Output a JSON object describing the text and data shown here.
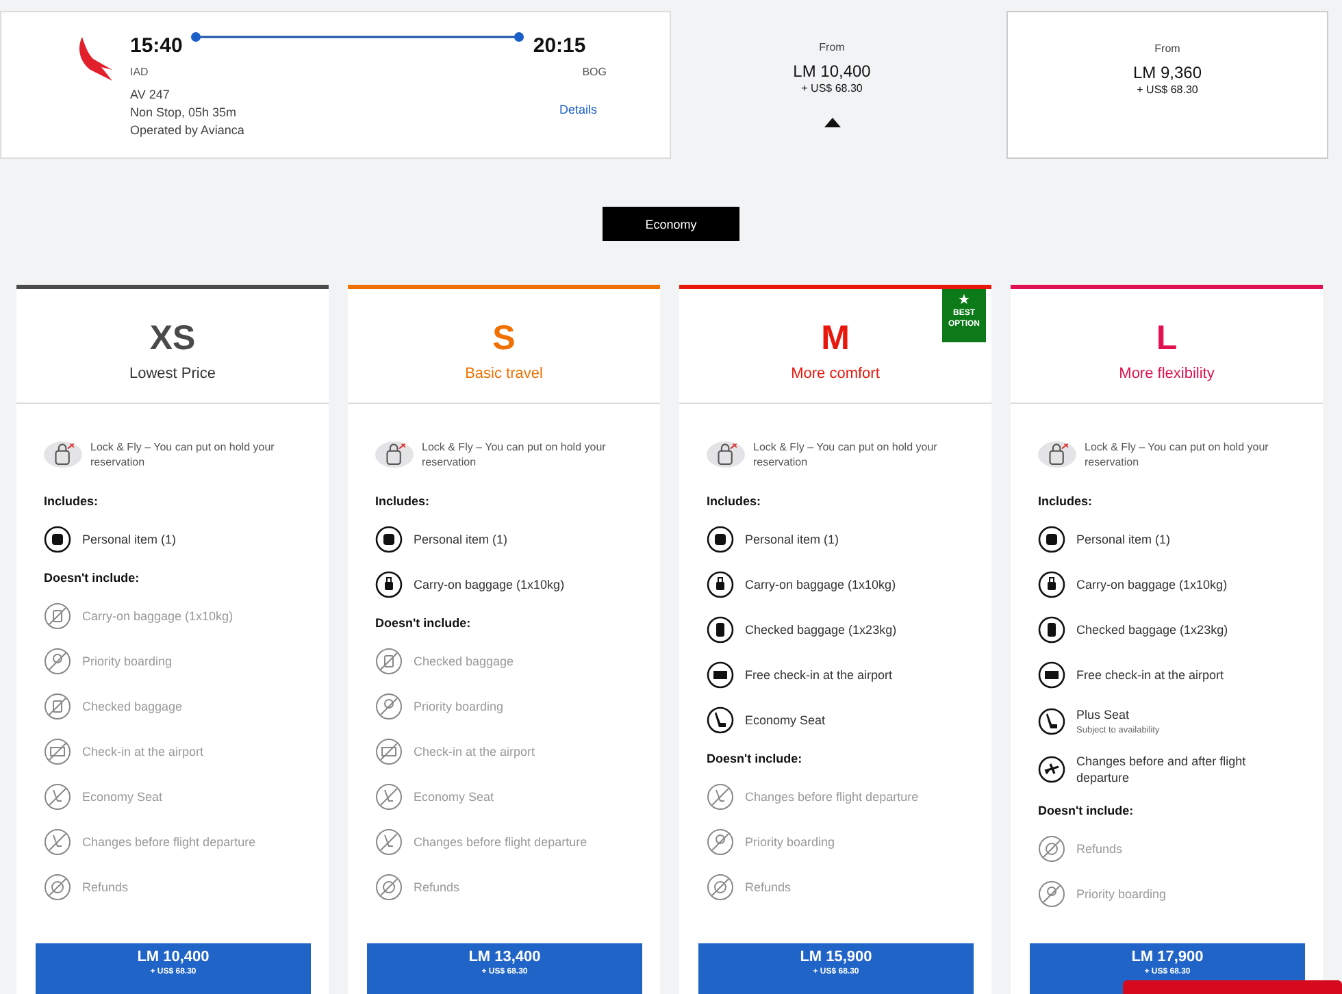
{
  "flight": {
    "departure_time": "15:40",
    "departure_airport": "IAD",
    "arrival_time": "20:15",
    "arrival_airport": "BOG",
    "flight_number": "AV 247",
    "duration": "Non Stop, 05h 35m",
    "operator": "Operated by Avianca",
    "details_link": "Details"
  },
  "fares": [
    {
      "from": "From",
      "price": "LM 10,400",
      "tax": "+ US$ 68.30",
      "selected": true
    },
    {
      "from": "From",
      "price": "LM 9,360",
      "tax": "+ US$ 68.30",
      "selected": false
    }
  ],
  "cabin_tab": "Economy",
  "plans": [
    {
      "code": "XS",
      "subtitle": "Lowest Price",
      "color": "#4a4a4a",
      "lock_text": "Lock & Fly – You can put on hold your reservation",
      "includes_label": "Includes:",
      "includes": [
        {
          "text": "Personal item (1)",
          "kind": "personal"
        }
      ],
      "excludes_label": "Doesn't include:",
      "excludes": [
        {
          "text": "Carry-on baggage (1x10kg)",
          "kind": "carryon"
        },
        {
          "text": "Priority boarding",
          "kind": "priority"
        },
        {
          "text": "Checked baggage",
          "kind": "checked"
        },
        {
          "text": "Check-in at the airport",
          "kind": "checkin"
        },
        {
          "text": "Economy Seat",
          "kind": "seat"
        },
        {
          "text": "Changes before flight departure",
          "kind": "changes"
        },
        {
          "text": "Refunds",
          "kind": "refunds"
        }
      ],
      "price": "LM 10,400",
      "tax": "+ US$ 68.30"
    },
    {
      "code": "S",
      "subtitle": "Basic travel",
      "color": "#f07000",
      "lock_text": "Lock & Fly – You can put on hold your reservation",
      "includes_label": "Includes:",
      "includes": [
        {
          "text": "Personal item (1)",
          "kind": "personal"
        },
        {
          "text": "Carry-on baggage (1x10kg)",
          "kind": "carryon"
        }
      ],
      "excludes_label": "Doesn't include:",
      "excludes": [
        {
          "text": "Checked baggage",
          "kind": "checked"
        },
        {
          "text": "Priority boarding",
          "kind": "priority"
        },
        {
          "text": "Check-in at the airport",
          "kind": "checkin"
        },
        {
          "text": "Economy Seat",
          "kind": "seat"
        },
        {
          "text": "Changes before flight departure",
          "kind": "changes"
        },
        {
          "text": "Refunds",
          "kind": "refunds"
        }
      ],
      "price": "LM 13,400",
      "tax": "+ US$ 68.30"
    },
    {
      "code": "M",
      "subtitle": "More comfort",
      "color": "#e8180c",
      "badge": {
        "star": "★",
        "text": "BEST OPTION"
      },
      "lock_text": "Lock & Fly – You can put on hold your reservation",
      "includes_label": "Includes:",
      "includes": [
        {
          "text": "Personal item (1)",
          "kind": "personal"
        },
        {
          "text": "Carry-on baggage (1x10kg)",
          "kind": "carryon"
        },
        {
          "text": "Checked baggage (1x23kg)",
          "kind": "checked"
        },
        {
          "text": "Free check-in at the airport",
          "kind": "checkin"
        },
        {
          "text": "Economy Seat",
          "kind": "seat"
        }
      ],
      "excludes_label": "Doesn't include:",
      "excludes": [
        {
          "text": "Changes before flight departure",
          "kind": "changes"
        },
        {
          "text": "Priority boarding",
          "kind": "priority"
        },
        {
          "text": "Refunds",
          "kind": "refunds"
        }
      ],
      "price": "LM 15,900",
      "tax": "+ US$ 68.30"
    },
    {
      "code": "L",
      "subtitle": "More flexibility",
      "color": "#e0114e",
      "lock_text": "Lock & Fly – You can put on hold your reservation",
      "includes_label": "Includes:",
      "includes": [
        {
          "text": "Personal item (1)",
          "kind": "personal"
        },
        {
          "text": "Carry-on baggage (1x10kg)",
          "kind": "carryon"
        },
        {
          "text": "Checked baggage (1x23kg)",
          "kind": "checked"
        },
        {
          "text": "Free check-in at the airport",
          "kind": "checkin"
        },
        {
          "text": "Plus Seat",
          "note": "Subject to availability",
          "kind": "seat"
        },
        {
          "text": "Changes before and after flight departure",
          "kind": "changes"
        }
      ],
      "excludes_label": "Doesn't include:",
      "excludes": [
        {
          "text": "Refunds",
          "kind": "refunds"
        },
        {
          "text": "Priority boarding",
          "kind": "priority"
        }
      ],
      "price": "LM 17,900",
      "tax": "+ US$ 68.30"
    }
  ]
}
